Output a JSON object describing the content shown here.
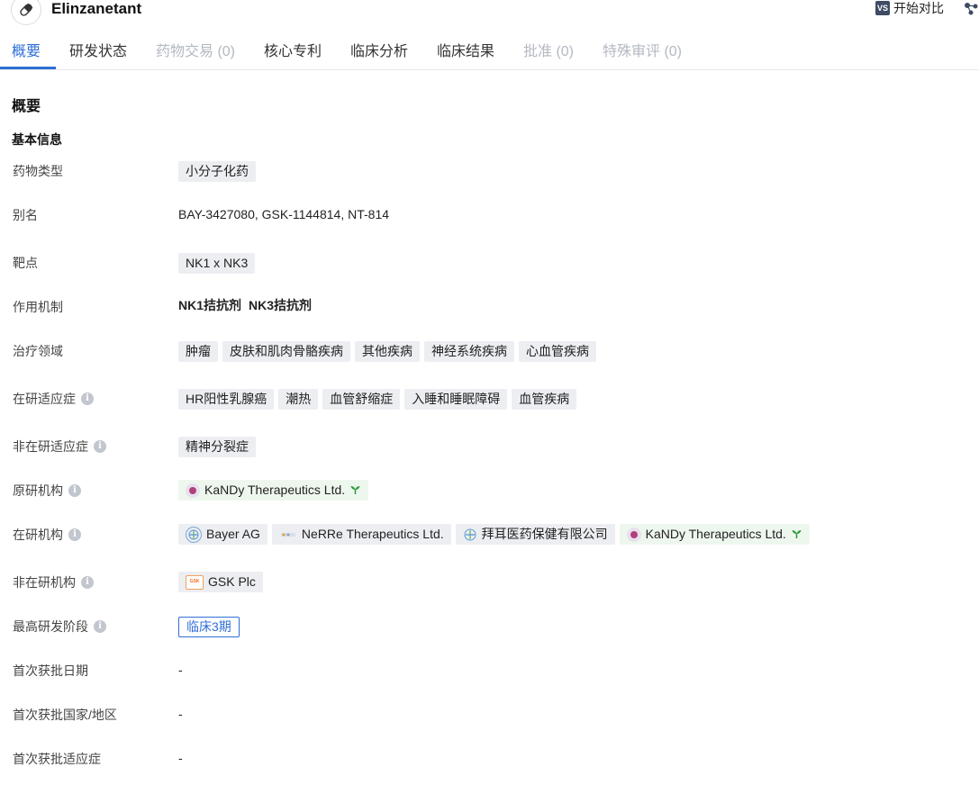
{
  "header": {
    "title": "Elinzanetant",
    "compare_badge": "VS",
    "compare_label": "开始对比"
  },
  "tabs": [
    {
      "label": "概要",
      "state": "active"
    },
    {
      "label": "研发状态",
      "state": "normal"
    },
    {
      "label": "药物交易 (0)",
      "state": "disabled"
    },
    {
      "label": "核心专利",
      "state": "normal"
    },
    {
      "label": "临床分析",
      "state": "normal"
    },
    {
      "label": "临床结果",
      "state": "normal"
    },
    {
      "label": "批准 (0)",
      "state": "disabled"
    },
    {
      "label": "特殊审评 (0)",
      "state": "disabled"
    }
  ],
  "overview": {
    "section_title": "概要",
    "basic_info_title": "基本信息",
    "info_glyph": "i",
    "rows": {
      "drug_type": {
        "label": "药物类型",
        "tags": [
          "小分子化药"
        ]
      },
      "aliases": {
        "label": "别名",
        "text": "BAY-3427080, GSK-1144814, NT-814"
      },
      "target": {
        "label": "靶点",
        "tags": [
          "NK1 x NK3"
        ]
      },
      "mechanism": {
        "label": "作用机制",
        "items": [
          "NK1拮抗剂",
          "NK3拮抗剂"
        ]
      },
      "therapeutic_area": {
        "label": "治疗领域",
        "tags": [
          "肿瘤",
          "皮肤和肌肉骨骼疾病",
          "其他疾病",
          "神经系统疾病",
          "心血管疾病"
        ]
      },
      "active_indications": {
        "label": "在研适应症",
        "tags": [
          "HR阳性乳腺癌",
          "潮热",
          "血管舒缩症",
          "入睡和睡眠障碍",
          "血管疾病"
        ]
      },
      "inactive_indications": {
        "label": "非在研适应症",
        "tags": [
          "精神分裂症"
        ]
      },
      "originator": {
        "label": "原研机构",
        "orgs": [
          {
            "name": "KaNDy Therapeutics Ltd.",
            "logo": "kandy-logo-icon",
            "highlight": true
          }
        ]
      },
      "active_orgs": {
        "label": "在研机构",
        "orgs": [
          {
            "name": "Bayer AG",
            "logo": "bayer-logo-icon",
            "highlight": false
          },
          {
            "name": "NeRRe Therapeutics Ltd.",
            "logo": "nerre-logo-icon",
            "highlight": false
          },
          {
            "name": "拜耳医药保健有限公司",
            "logo": "bayer-logo-icon",
            "highlight": false
          },
          {
            "name": "KaNDy Therapeutics Ltd.",
            "logo": "kandy-logo-icon",
            "highlight": true
          }
        ]
      },
      "inactive_orgs": {
        "label": "非在研机构",
        "orgs": [
          {
            "name": "GSK Plc",
            "logo": "gsk-logo-icon",
            "highlight": false,
            "logo_text": "GSK"
          }
        ]
      },
      "highest_phase": {
        "label": "最高研发阶段",
        "tag": "临床3期"
      },
      "first_approval_date": {
        "label": "首次获批日期",
        "text": "-"
      },
      "first_approval_region": {
        "label": "首次获批国家/地区",
        "text": "-"
      },
      "first_approval_indication": {
        "label": "首次获批适应症",
        "text": "-"
      }
    }
  },
  "colors": {
    "accent": "#2f6fd6",
    "tag_bg": "#eceef2",
    "green_tag_bg": "#eef7ee",
    "sprout": "#2b9a3a"
  }
}
